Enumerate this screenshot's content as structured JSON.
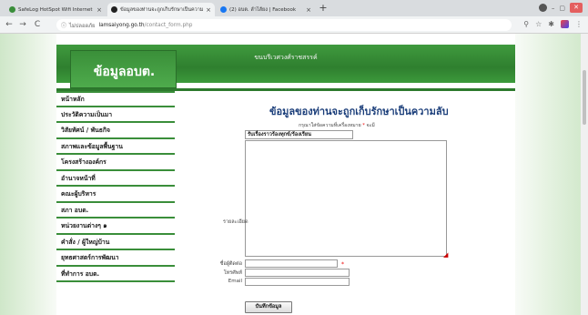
{
  "browser": {
    "tabs": [
      {
        "label": "SafeLog HotSpot Wifi Internet",
        "active": false,
        "favicon_color": "#3a8e3a"
      },
      {
        "label": "ข้อมูลของท่านจะถูกเก็บรักษาเป็นความลับ",
        "active": true,
        "favicon_color": "#222222"
      },
      {
        "label": "(2) อบต. ลำไส้ยง | Facebook",
        "active": false,
        "favicon_color": "#1877f2"
      }
    ],
    "new_tab_symbol": "+",
    "close_symbol": "×",
    "address": {
      "security_label": "ไม่ปลอดภัย",
      "host": "lamsaiyong.go.th",
      "path": "/contact_form.php"
    },
    "nav": {
      "back": "←",
      "forward": "→",
      "reload": "C"
    }
  },
  "site": {
    "banner_title": "ขนบรีเวศวงศ์ราชสรรค์",
    "logo_text": "ข้อมูลอบต.",
    "menu": [
      "หน้าหลัก",
      "ประวัติความเป็นมา",
      "วิสัยทัศน์ / พันธกิจ",
      "สภาพและข้อมูลพื้นฐาน",
      "โครงสร้างองค์กร",
      "อำนาจหน้าที่",
      "คณะผู้บริหาร",
      "สภา อบต.",
      "หน่วยงานต่างๆ ๑",
      "คำสั่ง / ผู้ใหญ่บ้าน",
      "ยุทธศาสตร์การพัฒนา",
      "ที่ทำการ อบต."
    ]
  },
  "form": {
    "heading": "ข้อมูลของท่านจะถูกเก็บรักษาเป็นความลับ",
    "required_note": "กรุณาใส่ข้อความที่เครื่องหมาย",
    "required_star": "*",
    "required_note_suffix": "จะมี",
    "subject_value": "รับเรื่องราวร้องทุกข์/ร้องเรียน",
    "detail_label": "รายละเอียด",
    "detail_value": "",
    "contact_label": "ชื่อผู้ติดต่อ",
    "phone_label": "โทรศัพท์",
    "email_label": "Email",
    "contact_value": "",
    "phone_value": "",
    "email_value": "",
    "submit_label": "บันทึกข้อมูล"
  }
}
